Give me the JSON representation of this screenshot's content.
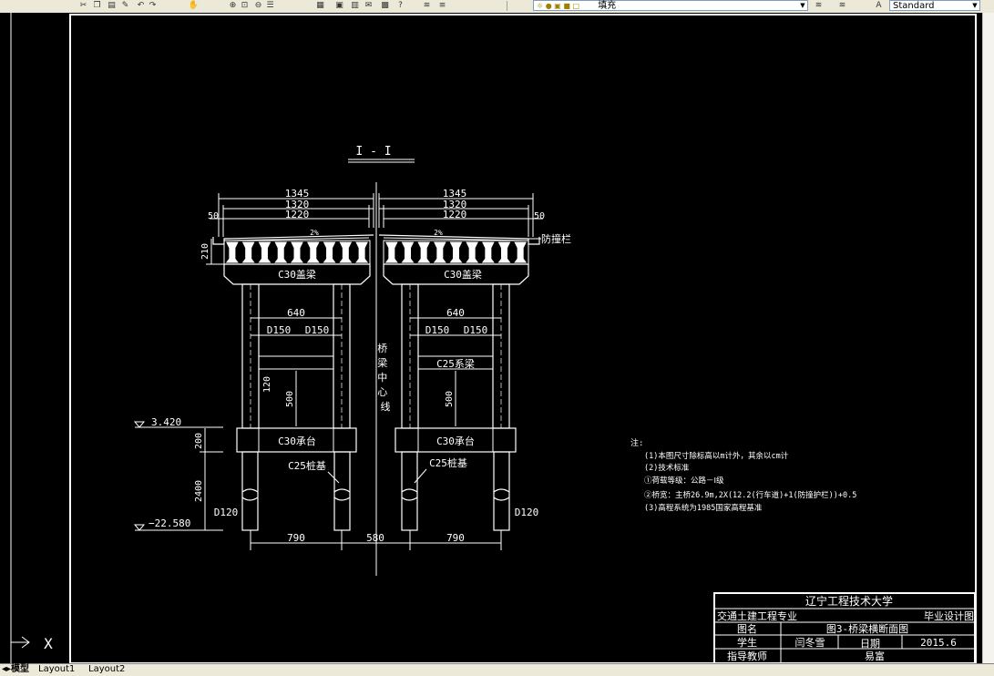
{
  "toolbar": {
    "icons": [
      "cut-icon",
      "copy-icon",
      "paste-icon",
      "match-properties-icon",
      "undo-icon",
      "redo-icon",
      "pan-icon",
      "zoom-realtime-icon",
      "zoom-window-icon",
      "zoom-previous-icon",
      "properties-icon",
      "design-center-icon",
      "tool-palettes-icon",
      "sheet-set-icon",
      "markup-icon",
      "calculator-icon",
      "help-icon",
      "layers-icon",
      "layer-state-icon"
    ],
    "layer_value": "填充",
    "style_value": "Standard"
  },
  "drawing": {
    "section_title": "I - I",
    "dims": {
      "top_total_left": "1345",
      "top_mid_left": "1320",
      "top_inner_left": "1220",
      "top_total_right": "1345",
      "top_mid_right": "1320",
      "top_inner_right": "1220",
      "edge_left": "50",
      "edge_right": "50",
      "beam_height": "210",
      "col_spacing_left": "640",
      "col_spacing_right": "640",
      "d150_1": "D150",
      "d150_2": "D150",
      "d150_3": "D150",
      "d150_4": "D150",
      "tie_height": "120",
      "clear_height": "500",
      "clear_height_right": "500",
      "cap_height": "200",
      "pile_len": "2400",
      "pile_d_left": "D120",
      "pile_d_right": "D120",
      "bottom_left": "790",
      "bottom_mid": "580",
      "bottom_right": "790"
    },
    "labels": {
      "slope_left": "2%",
      "slope_right": "2%",
      "guardrail": "防撞栏",
      "cap_beam_left": "C30盖梁",
      "cap_beam_right": "C30盖梁",
      "tie_beam": "C25系梁",
      "pile_cap_left": "C30承台",
      "pile_cap_right": "C30承台",
      "pile_left": "C25桩基",
      "pile_right": "C25桩基",
      "centerline": "桥梁中心线",
      "elev_top": "3.420",
      "elev_bottom": "−22.580"
    },
    "notes": {
      "heading": "注:",
      "lines": [
        "(1)本图尺寸除标高以m计外，其余以cm计",
        "(2)技术标准",
        "  ①荷载等级：公路－Ⅰ级",
        "  ②桥宽：主桥26.9m,2X(12.2(行车道)+1(防撞护栏))+0.5",
        "(3)高程系统为1985国家高程基准"
      ]
    },
    "title_block": {
      "school": "辽宁工程技术大学",
      "major": "交通土建工程专业",
      "design_type": "毕业设计图",
      "drawing_name_label": "图名",
      "drawing_name": "图3-桥梁横断面图",
      "student_label": "学生",
      "student": "闫冬雪",
      "date_label": "日期",
      "date": "2015.6",
      "advisor_label": "指导教师",
      "advisor": "易富"
    },
    "ucs_label": "X"
  },
  "tabs": {
    "model": "模型",
    "layout1": "Layout1",
    "layout2": "Layout2"
  }
}
